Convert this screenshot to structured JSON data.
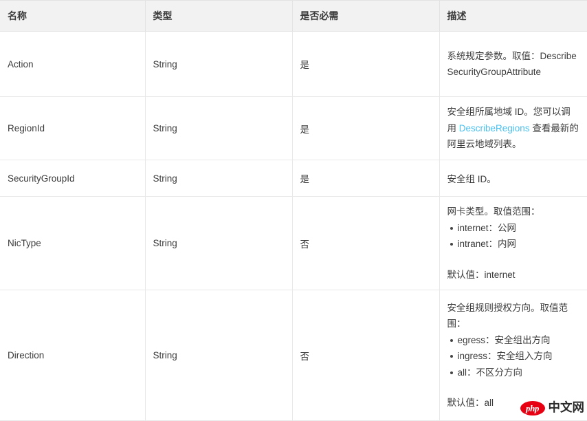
{
  "table": {
    "headers": [
      {
        "label": "名称"
      },
      {
        "label": "类型"
      },
      {
        "label": "是否必需"
      },
      {
        "label": "描述"
      }
    ],
    "rows": [
      {
        "name": "Action",
        "type": "String",
        "required": "是",
        "desc_lead": "系统规定参数。取值：DescribeSecurityGroupAttribute",
        "bullets": [],
        "desc_default": ""
      },
      {
        "name": "RegionId",
        "type": "String",
        "required": "是",
        "desc_before_link": "安全组所属地域 ID。您可以调用 ",
        "desc_link": "DescribeRegions",
        "desc_after_link": " 查看最新的阿里云地域列表。",
        "bullets": [],
        "desc_default": ""
      },
      {
        "name": "SecurityGroupId",
        "type": "String",
        "required": "是",
        "desc_lead": "安全组 ID。",
        "bullets": [],
        "desc_default": ""
      },
      {
        "name": "NicType",
        "type": "String",
        "required": "否",
        "desc_lead": "网卡类型。取值范围：",
        "bullets": [
          "internet：公网",
          "intranet：内网"
        ],
        "desc_default": "默认值：internet"
      },
      {
        "name": "Direction",
        "type": "String",
        "required": "否",
        "desc_lead": "安全组规则授权方向。取值范围：",
        "bullets": [
          "egress：安全组出方向",
          "ingress：安全组入方向",
          "all：不区分方向"
        ],
        "desc_default": "默认值：all"
      }
    ]
  },
  "watermark": {
    "badge_text": "php",
    "site_text": "中文网"
  },
  "colors": {
    "link": "#49c0f0",
    "header_bg": "#f2f2f2",
    "border": "#e8e8e8",
    "text": "#3b3b3b",
    "watermark_red": "#e60012"
  }
}
